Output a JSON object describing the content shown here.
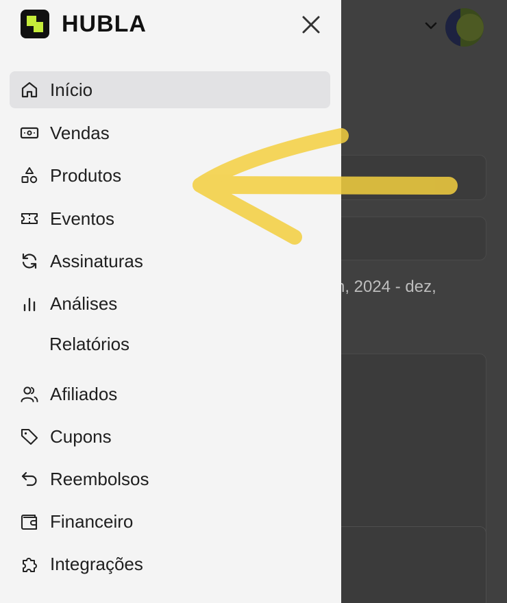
{
  "background_app": {
    "date_range_text": "n, 2024 - dez,"
  },
  "brand": {
    "name": "HUBLA"
  },
  "nav": {
    "items": [
      {
        "label": "Início",
        "icon": "home-icon",
        "active": true
      },
      {
        "label": "Vendas",
        "icon": "banknote-icon"
      },
      {
        "label": "Produtos",
        "icon": "shapes-icon"
      },
      {
        "label": "Eventos",
        "icon": "ticket-icon"
      },
      {
        "label": "Assinaturas",
        "icon": "refresh-icon"
      },
      {
        "label": "Análises",
        "icon": "bar-chart-icon"
      },
      {
        "label": "Relatórios",
        "icon": null
      },
      {
        "label": "Afiliados",
        "icon": "users-icon"
      },
      {
        "label": "Cupons",
        "icon": "tag-icon"
      },
      {
        "label": "Reembolsos",
        "icon": "undo-icon"
      },
      {
        "label": "Financeiro",
        "icon": "wallet-icon"
      },
      {
        "label": "Integrações",
        "icon": "puzzle-icon"
      }
    ]
  },
  "colors": {
    "drawer_bg": "#f4f4f4",
    "active_bg": "#e2e2e4",
    "logo_green": "#c5ec3a",
    "annotation_yellow": "#f3cf3f"
  }
}
